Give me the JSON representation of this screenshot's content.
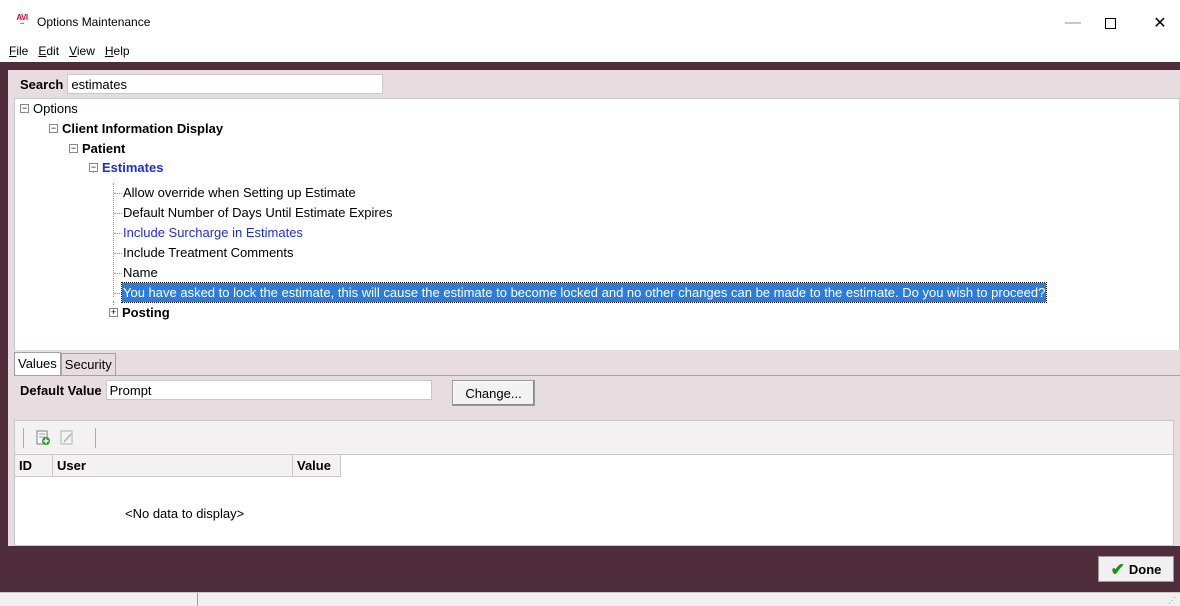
{
  "window": {
    "title": "Options Maintenance",
    "logo_text": "AVI",
    "minimize_glyph": "—",
    "close_glyph": "✕"
  },
  "menu": [
    {
      "label": "File",
      "mnemonic": "F",
      "rest": "ile"
    },
    {
      "label": "Edit",
      "mnemonic": "E",
      "rest": "dit"
    },
    {
      "label": "View",
      "mnemonic": "V",
      "rest": "iew"
    },
    {
      "label": "Help",
      "mnemonic": "H",
      "rest": "elp"
    }
  ],
  "search": {
    "label": "Search",
    "value": "estimates"
  },
  "tree": {
    "root": "Options",
    "client_info": "Client Information Display",
    "patient": "Patient",
    "estimates": "Estimates",
    "children": [
      "Allow override when Setting up Estimate",
      "Default Number of Days Until Estimate Expires",
      "Include Surcharge in Estimates",
      "Include Treatment Comments",
      "Name",
      "You have asked to lock the estimate, this will cause the estimate to become locked and no other changes can be made to the estimate. Do you wish to proceed?"
    ],
    "posting": "Posting"
  },
  "tabs": {
    "values": "Values",
    "security": "Security"
  },
  "default_value": {
    "label": "Default Value",
    "value": "Prompt",
    "change_button": "Change..."
  },
  "grid": {
    "columns": [
      "ID",
      "User",
      "Value"
    ],
    "empty_text": "<No data to display>"
  },
  "done_button": "Done",
  "colors": {
    "frame": "#4f2d3a",
    "panel": "#e7dde0",
    "selection": "#2d7dd8",
    "link_blue": "#1f2fd1",
    "check_green": "#1a8d1a"
  }
}
